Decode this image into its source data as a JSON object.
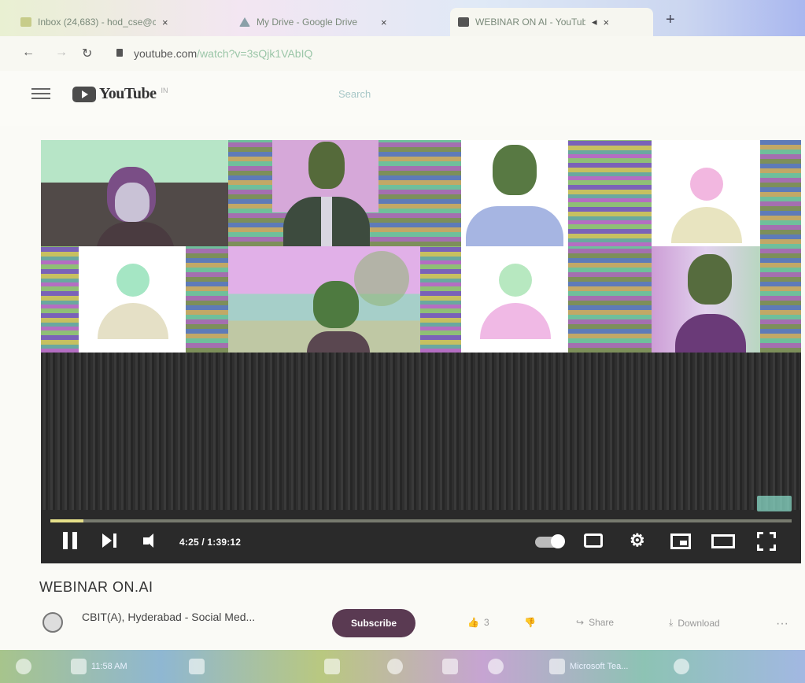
{
  "browser": {
    "tabs": [
      {
        "title": "Inbox (24,683) - hod_cse@cbit...",
        "active": false
      },
      {
        "title": "My Drive - Google Drive",
        "active": false
      },
      {
        "title": "WEBINAR ON AI - YouTube",
        "active": true
      }
    ],
    "url_domain": "youtube.com",
    "url_path": "/watch?v=3sQjk1VAbIQ"
  },
  "youtube": {
    "logo_text": "YouTube",
    "country_code": "IN",
    "search_placeholder": "Search"
  },
  "player": {
    "time_display": "4:25 / 1:39:12",
    "progress_fraction": 0.045,
    "quality_badge": ""
  },
  "video": {
    "title": "WEBINAR ON.AI",
    "channel_name": "CBIT(A), Hyderabad - Social Med...",
    "subscribers": "",
    "subscribe_label": "Subscribe",
    "like_count": "3",
    "share_label": "Share",
    "download_label": "Download",
    "more_label": "···"
  },
  "taskbar": {
    "items": [
      "",
      "11:58 AM",
      "",
      "",
      "",
      "",
      "",
      "Microsoft Tea...",
      ""
    ]
  },
  "colors": {
    "subscribe_bg": "#5a3a52",
    "progress_fill": "#e6e08a"
  }
}
